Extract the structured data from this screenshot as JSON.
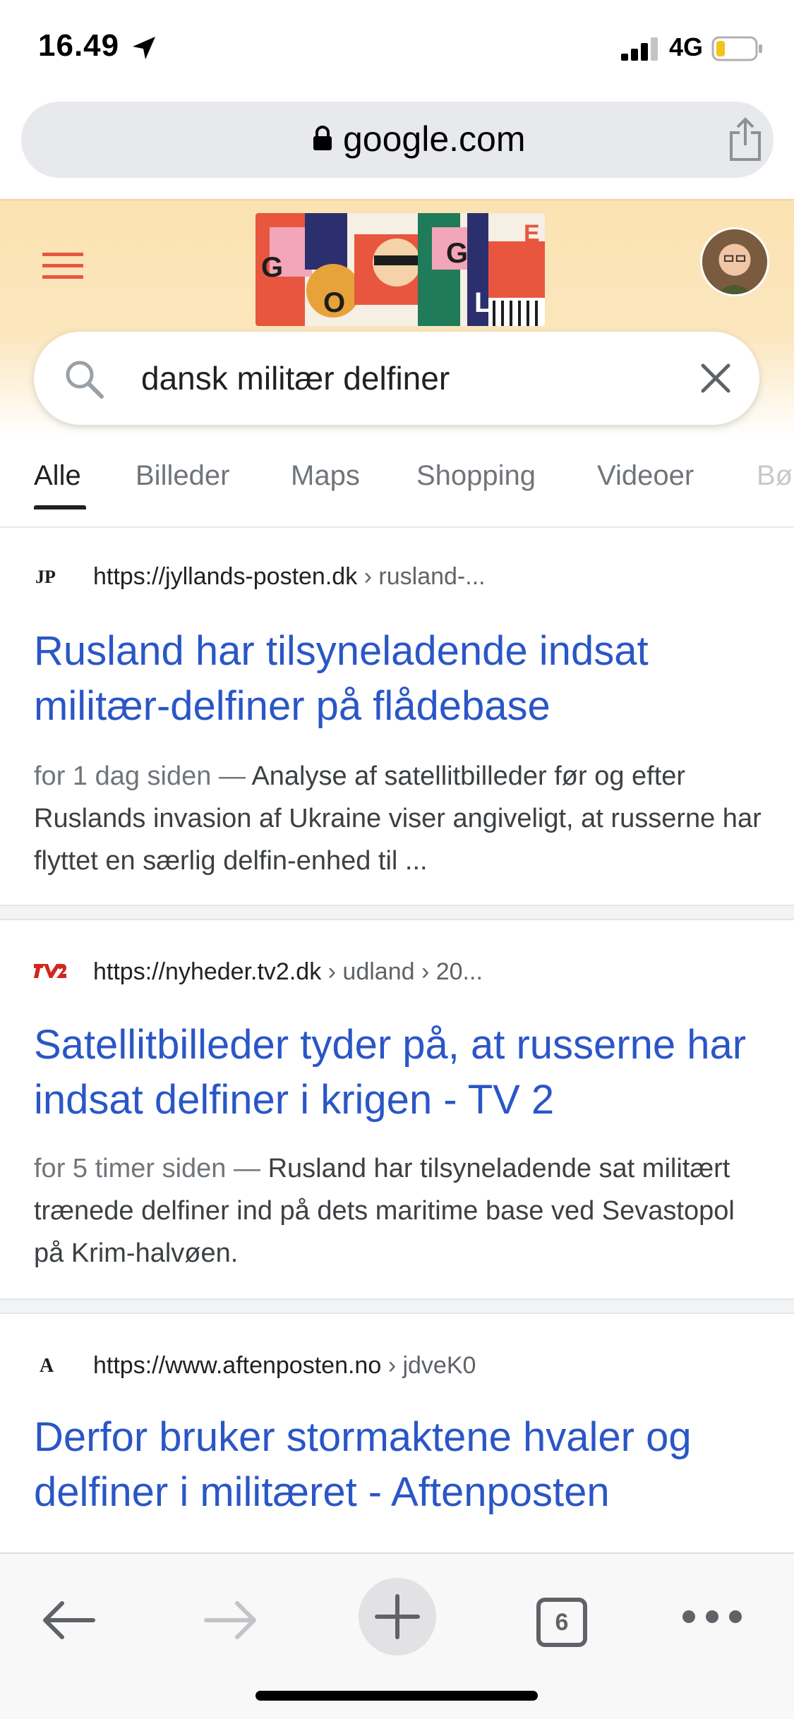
{
  "status_bar": {
    "time": "16.49",
    "network": "4G",
    "icons": [
      "location-arrow-icon",
      "signal-bars-icon",
      "battery-low-icon"
    ]
  },
  "browser": {
    "url": "google.com",
    "icons": [
      "lock-icon",
      "share-icon"
    ]
  },
  "search": {
    "query": "dansk militær delfiner",
    "icons": [
      "search-icon",
      "clear-icon",
      "menu-icon"
    ]
  },
  "tabs": [
    {
      "label": "Alle",
      "active": true
    },
    {
      "label": "Billeder",
      "active": false
    },
    {
      "label": "Maps",
      "active": false
    },
    {
      "label": "Shopping",
      "active": false
    },
    {
      "label": "Videoer",
      "active": false
    },
    {
      "label": "Bø",
      "active": false
    }
  ],
  "results": [
    {
      "favicon_text": "JP",
      "url": "https://jyllands-posten.dk",
      "crumb": " › rusland-...",
      "title": "Rusland har tilsyneladende indsat militær-delfiner på flådebase",
      "date": "for 1 dag siden",
      "snippet": "Analyse af satellitbilleder før og efter Ruslands invasion af Ukraine viser angiveligt, at russerne har flyttet en særlig delfin-enhed til ..."
    },
    {
      "favicon_text": "TV2",
      "url": "https://nyheder.tv2.dk",
      "crumb": " › udland › 20...",
      "title": "Satellitbilleder tyder på, at russerne har indsat delfiner i krigen - TV 2",
      "date": "for 5 timer siden",
      "snippet": "Rusland har tilsyneladende sat militært trænede delfiner ind på dets maritime base ved Sevastopol på Krim-halvøen."
    },
    {
      "favicon_text": "A",
      "url": "https://www.aftenposten.no",
      "crumb": " › jdveK0",
      "title": "Derfor bruker stormaktene hvaler og delfiner i militæret - Aftenposten"
    }
  ],
  "toolbar": {
    "tab_count": "6",
    "icons": [
      "back-arrow-icon",
      "forward-arrow-icon",
      "new-tab-plus-icon",
      "tab-switcher-icon",
      "more-dots-icon"
    ]
  },
  "colors": {
    "link": "#2a56c6",
    "header_bg": "#fbe2b2",
    "menu_icon": "#e8563f"
  }
}
